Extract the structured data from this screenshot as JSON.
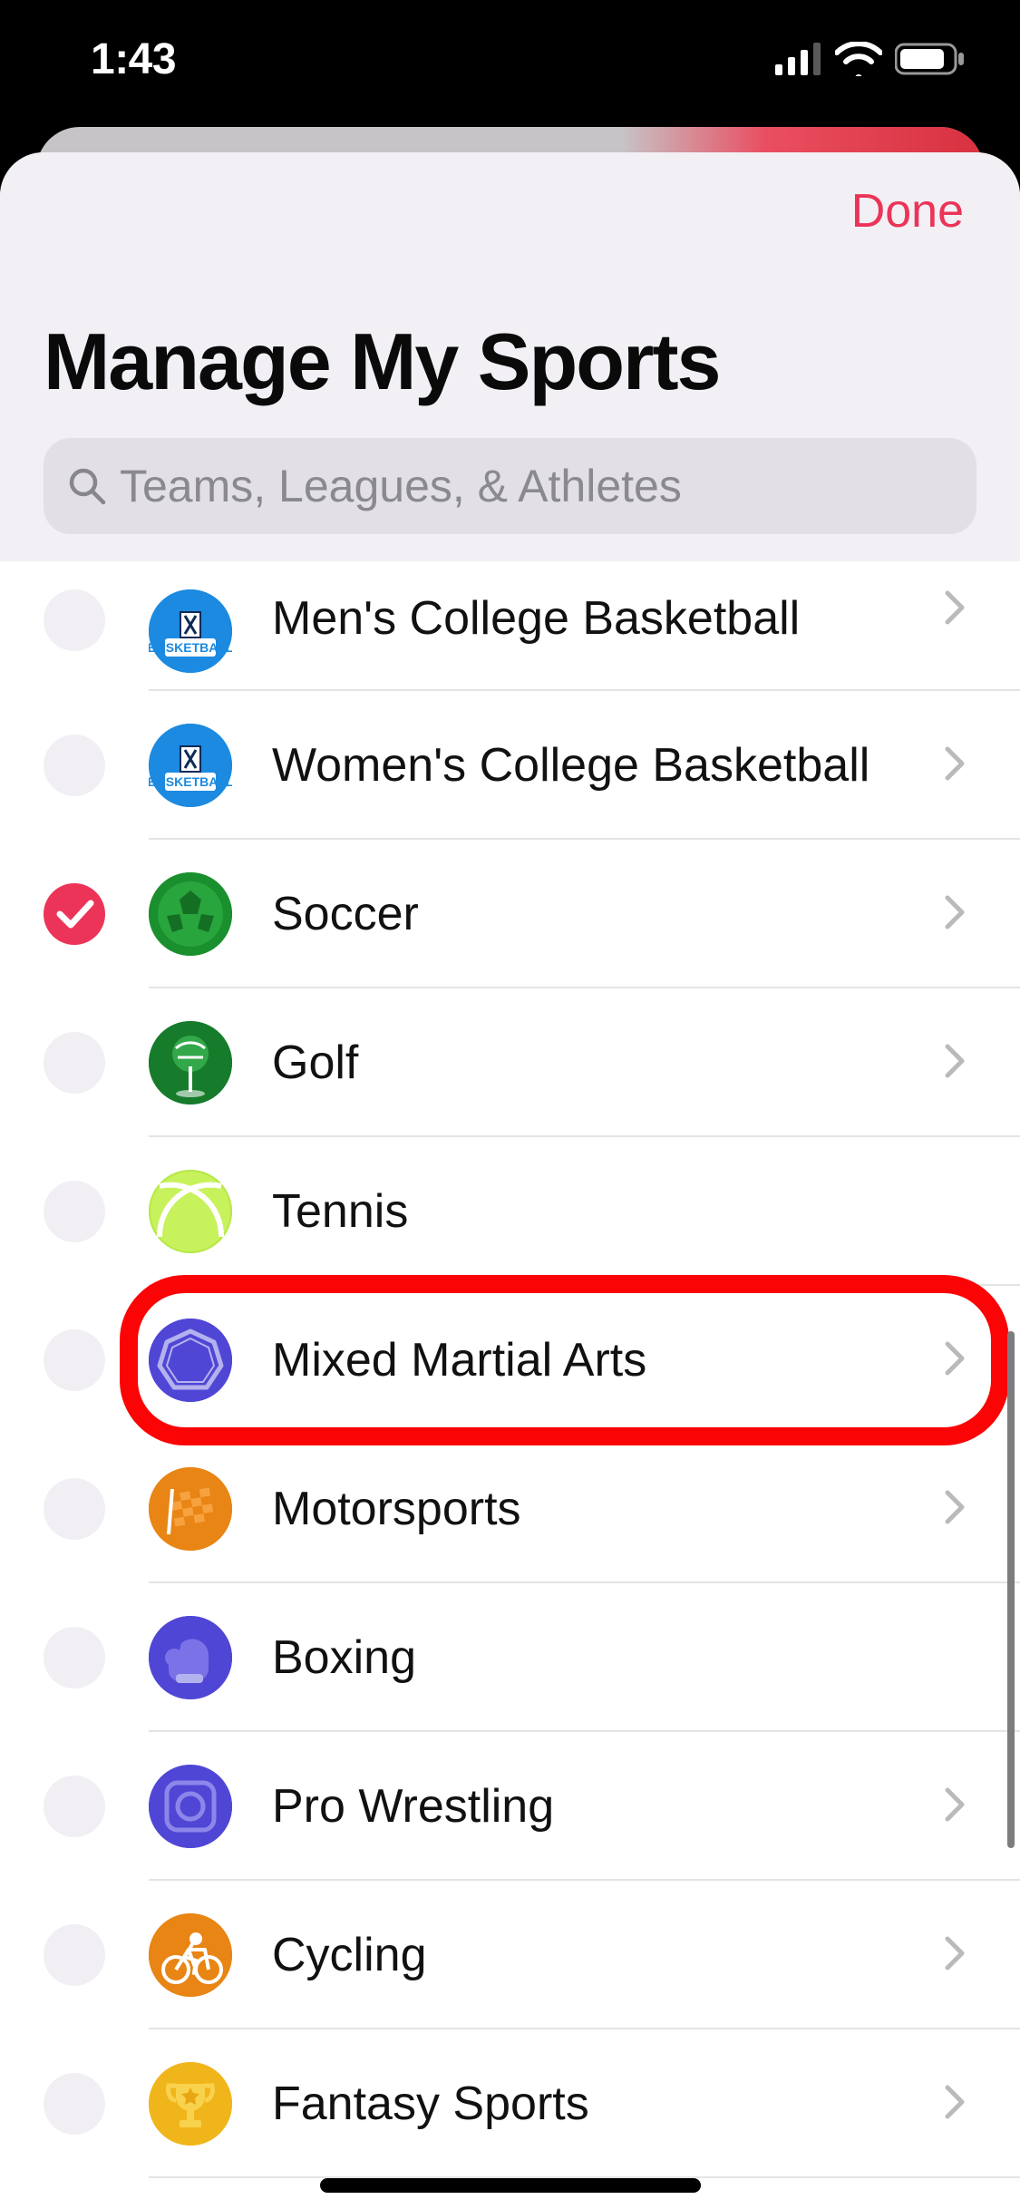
{
  "status": {
    "time": "1:43"
  },
  "header": {
    "done": "Done",
    "title": "Manage My Sports",
    "search_placeholder": "Teams, Leagues, & Athletes"
  },
  "sports": [
    {
      "id": "mens-college-basketball",
      "label": "Men's College Basketball",
      "selected": false,
      "icon_bg": "#1b8ae0",
      "icon": "ncaa-basketball",
      "chevron": true,
      "partial": true
    },
    {
      "id": "womens-college-basketball",
      "label": "Women's College Basketball",
      "selected": false,
      "icon_bg": "#1b8ae0",
      "icon": "ncaa-basketball",
      "chevron": true
    },
    {
      "id": "soccer",
      "label": "Soccer",
      "selected": true,
      "icon_bg": "#1a8f2d",
      "icon": "soccer",
      "chevron": true
    },
    {
      "id": "golf",
      "label": "Golf",
      "selected": false,
      "icon_bg": "#167c2b",
      "icon": "golf",
      "chevron": true
    },
    {
      "id": "tennis",
      "label": "Tennis",
      "selected": false,
      "icon_bg": "#b6e84a",
      "icon": "tennis",
      "chevron": false
    },
    {
      "id": "mixed-martial-arts",
      "label": "Mixed Martial Arts",
      "selected": false,
      "icon_bg": "#5046d5",
      "icon": "mma",
      "chevron": true,
      "highlighted": true
    },
    {
      "id": "motorsports",
      "label": "Motorsports",
      "selected": false,
      "icon_bg": "#e88514",
      "icon": "flag",
      "chevron": true
    },
    {
      "id": "boxing",
      "label": "Boxing",
      "selected": false,
      "icon_bg": "#5046d5",
      "icon": "boxing",
      "chevron": false
    },
    {
      "id": "pro-wrestling",
      "label": "Pro Wrestling",
      "selected": false,
      "icon_bg": "#5046d5",
      "icon": "wrestling",
      "chevron": true
    },
    {
      "id": "cycling",
      "label": "Cycling",
      "selected": false,
      "icon_bg": "#e88514",
      "icon": "cycling",
      "chevron": true
    },
    {
      "id": "fantasy-sports",
      "label": "Fantasy Sports",
      "selected": false,
      "icon_bg": "#f1b51c",
      "icon": "trophy",
      "chevron": true
    }
  ]
}
